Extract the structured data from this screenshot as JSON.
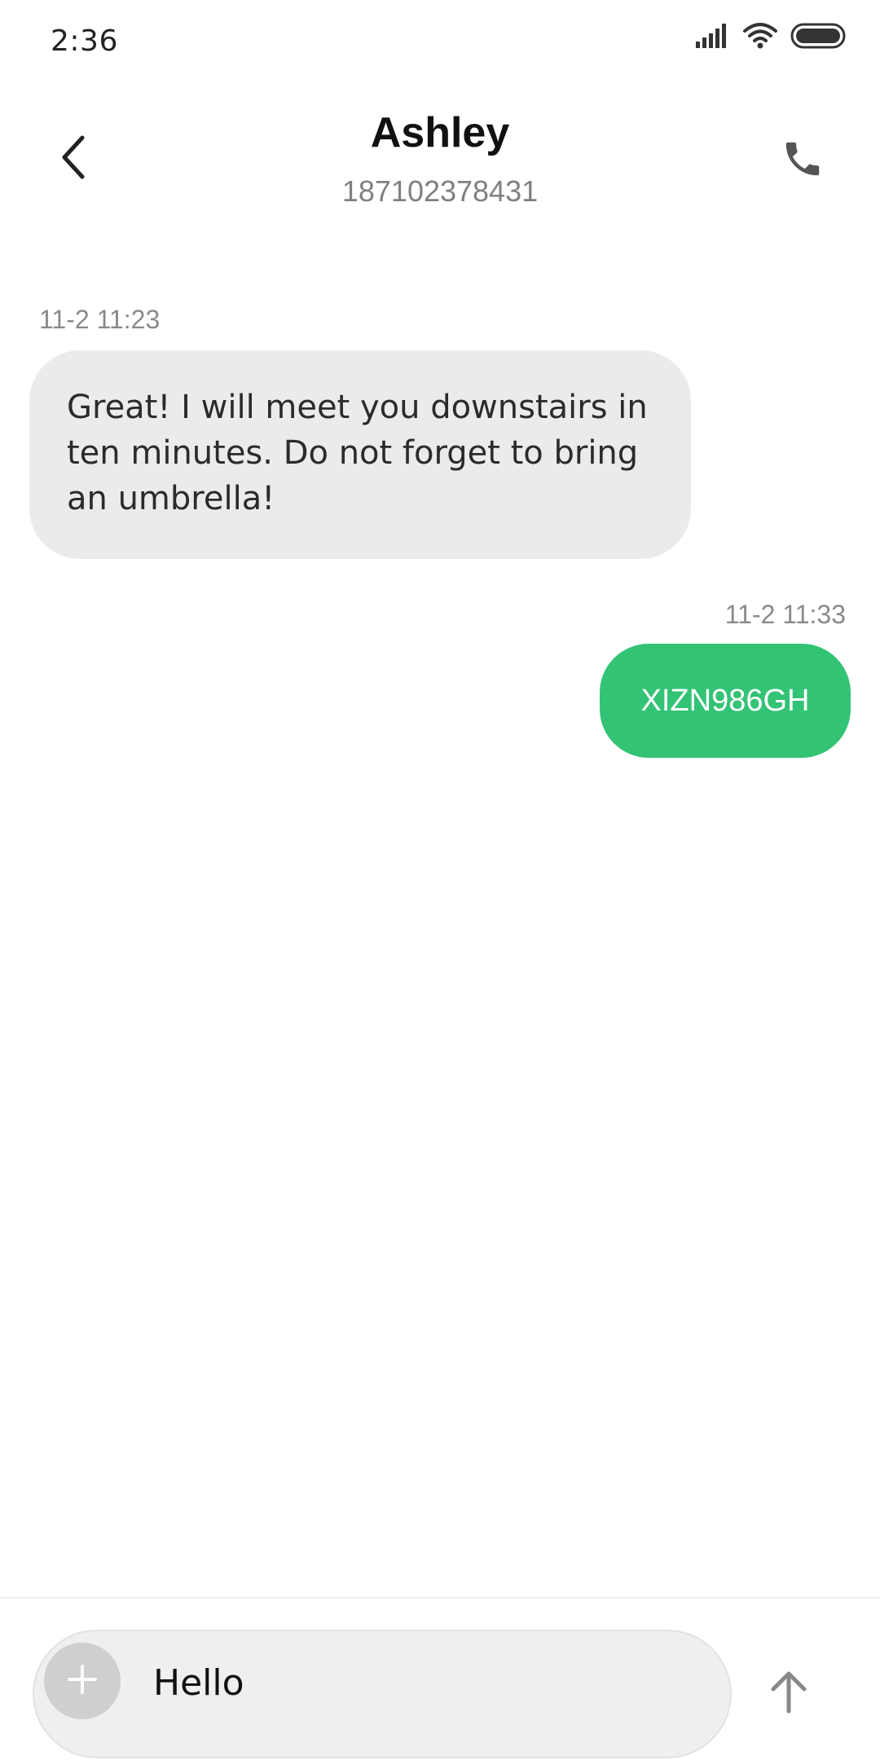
{
  "status_bar": {
    "time": "2:36",
    "icons": [
      "signal-icon",
      "wifi-icon",
      "battery-icon"
    ]
  },
  "header": {
    "contact_name": "Ashley",
    "contact_number": "187102378431",
    "back_icon": "chevron-left-icon",
    "call_icon": "phone-icon"
  },
  "messages": [
    {
      "direction": "incoming",
      "timestamp": "11-2 11:23",
      "text": "Great! I will meet you downstairs in ten minutes. Do not forget to bring an umbrella!"
    },
    {
      "direction": "outgoing",
      "timestamp": "11-2 11:33",
      "text": "XIZN986GH"
    }
  ],
  "composer": {
    "value": "Hello",
    "attach_icon": "plus-icon",
    "send_icon": "arrow-up-icon"
  },
  "colors": {
    "outgoing_bubble": "#33c375",
    "incoming_bubble": "#ebebeb",
    "timestamp_text": "#8a8a8a"
  }
}
